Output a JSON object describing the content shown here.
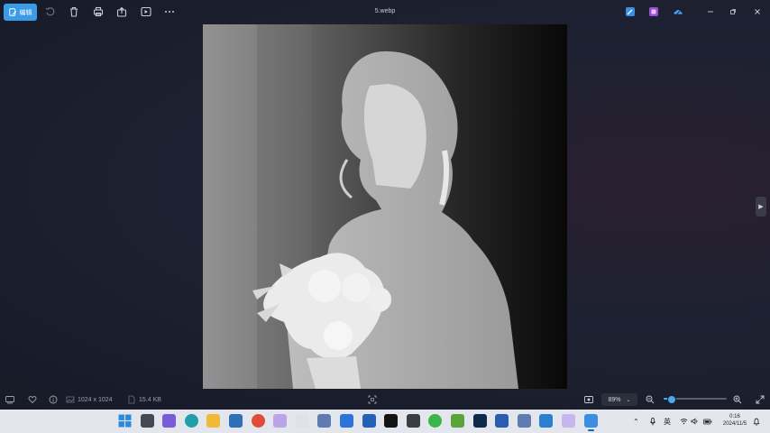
{
  "titlebar": {
    "edit_label": "编辑",
    "file_name": "5.webp",
    "icons": [
      "edit-icon",
      "rotate-icon",
      "delete-icon",
      "print-icon",
      "share-icon",
      "slideshow-icon",
      "more-icon"
    ],
    "right_icons": [
      "photo-editor-icon",
      "clipchamp-icon",
      "onedrive-icon"
    ],
    "window_controls": [
      "minimize",
      "restore",
      "close"
    ]
  },
  "statusbar": {
    "dimensions": "1024 x 1024",
    "file_size": "15.4 KB",
    "zoom": "89%",
    "zoom_fraction": 0.12
  },
  "taskbar": {
    "apps": [
      {
        "name": "start",
        "color": "#2b8ae0"
      },
      {
        "name": "file-manager",
        "color": "#444a55"
      },
      {
        "name": "app-violet",
        "color": "#7a5bd8"
      },
      {
        "name": "edge",
        "color": "#1fa0a8"
      },
      {
        "name": "file-explorer",
        "color": "#f0b93a"
      },
      {
        "name": "store",
        "color": "#2f6fb8"
      },
      {
        "name": "chrome",
        "color": "#e04b3a"
      },
      {
        "name": "app-purple",
        "color": "#b9a4e8"
      },
      {
        "name": "app-notes",
        "color": "#dfe2e8"
      },
      {
        "name": "app-network",
        "color": "#5f7bb0"
      },
      {
        "name": "app-blue",
        "color": "#2d73d8"
      },
      {
        "name": "app-v",
        "color": "#2162b8"
      },
      {
        "name": "capcut",
        "color": "#141414"
      },
      {
        "name": "terminal",
        "color": "#3a3d44"
      },
      {
        "name": "wechat",
        "color": "#3ab54a"
      },
      {
        "name": "app-green",
        "color": "#5aa53a"
      },
      {
        "name": "photoshop",
        "color": "#0e2a4a"
      },
      {
        "name": "app-gpu",
        "color": "#2a5db0"
      },
      {
        "name": "app-network2",
        "color": "#5f7bb0"
      },
      {
        "name": "app-media",
        "color": "#2c7fd0"
      },
      {
        "name": "app-lavender",
        "color": "#c7b6ee"
      },
      {
        "name": "photos",
        "color": "#3d8ee0"
      }
    ],
    "tray": {
      "ime": "英",
      "time": "0:16",
      "date": "2024/11/5"
    }
  }
}
